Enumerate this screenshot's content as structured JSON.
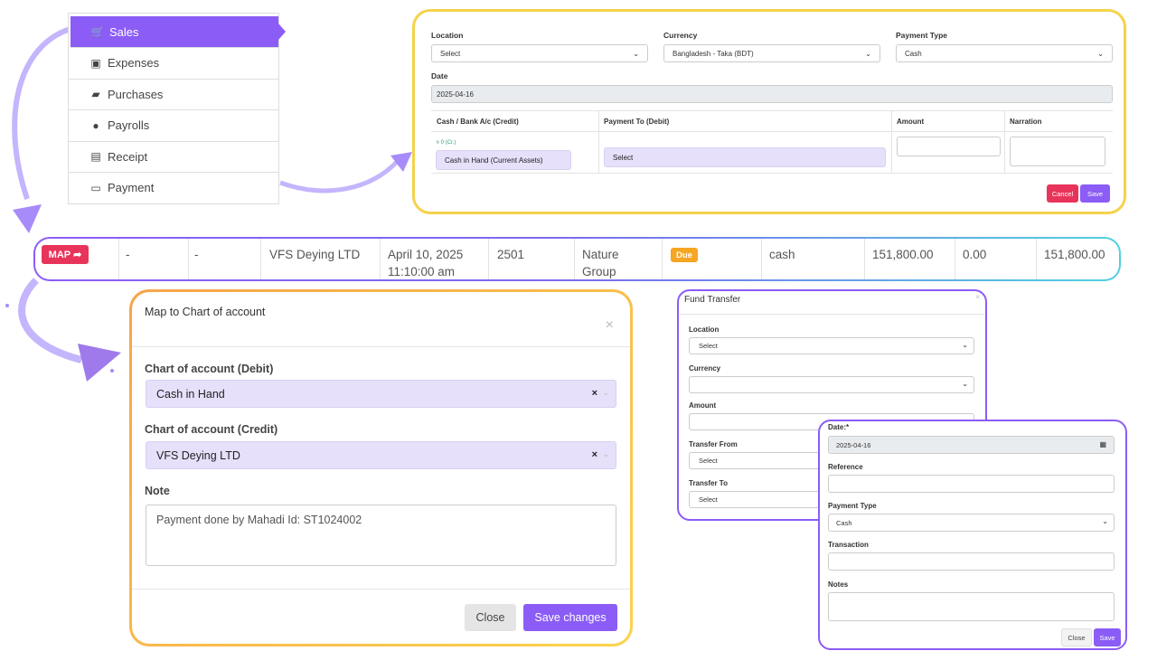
{
  "sidebar": {
    "items": [
      {
        "label": "Sales",
        "icon": "cart-icon",
        "active": true
      },
      {
        "label": "Expenses",
        "icon": "money-icon"
      },
      {
        "label": "Purchases",
        "icon": "truck-icon"
      },
      {
        "label": "Payrolls",
        "icon": "user-check-icon"
      },
      {
        "label": "Receipt",
        "icon": "receipt-icon"
      },
      {
        "label": "Payment",
        "icon": "credit-card-icon"
      }
    ]
  },
  "top_form": {
    "location_label": "Location",
    "location_value": "Select",
    "currency_label": "Currency",
    "currency_value": "Bangladesh - Taka (BDT)",
    "payment_type_label": "Payment Type",
    "payment_type_value": "Cash",
    "date_label": "Date",
    "date_value": "2025-04-16",
    "col_cash_bank": "Cash / Bank A/c (Credit)",
    "col_payment_to": "Payment To (Debit)",
    "col_amount": "Amount",
    "col_narration": "Narration",
    "balance_hint": "৳ 0 (Cr.)",
    "cash_account_value": "Cash in Hand (Current Assets)",
    "payment_to_value": "Select",
    "cancel_label": "Cancel",
    "save_label": "Save"
  },
  "row": {
    "map_label": "MAP",
    "col1": "-",
    "col2": "-",
    "supplier": "VFS Deying LTD",
    "date": "April 10, 2025",
    "time": "11:10:00 am",
    "ref": "2501",
    "group_line1": "Nature",
    "group_line2": "Group",
    "status": "Due",
    "method": "cash",
    "total": "151,800.00",
    "paid": "0.00",
    "due": "151,800.00"
  },
  "map_modal": {
    "title": "Map to Chart of account",
    "close_glyph": "×",
    "debit_label": "Chart of account (Debit)",
    "debit_value": "Cash in Hand",
    "credit_label": "Chart of account (Credit)",
    "credit_value": "VFS Deying LTD",
    "note_label": "Note",
    "note_value": "Payment done by Mahadi Id: ST1024002",
    "close_label": "Close",
    "save_label": "Save changes"
  },
  "fund_transfer": {
    "title": "Fund Transfer",
    "location_label": "Location",
    "location_value": "Select",
    "currency_label": "Currency",
    "currency_value": "",
    "amount_label": "Amount",
    "transfer_from_label": "Transfer From",
    "transfer_from_value": "Select",
    "transfer_to_label": "Transfer To",
    "transfer_to_value": "Select"
  },
  "payment_panel": {
    "date_label": "Date:*",
    "date_value": "2025-04-16",
    "reference_label": "Reference",
    "payment_type_label": "Payment Type",
    "payment_type_value": "Cash",
    "transaction_label": "Transaction",
    "notes_label": "Notes",
    "close_label": "Close",
    "save_label": "Save"
  },
  "colors": {
    "accent": "#8b5cf6",
    "danger": "#e8345a",
    "warning": "#f5a623",
    "highlight": "#e6e0fa"
  }
}
